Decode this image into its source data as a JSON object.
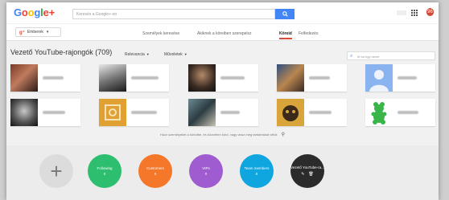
{
  "header": {
    "logo_letters": [
      {
        "ch": "G",
        "color": "#4285f4"
      },
      {
        "ch": "o",
        "color": "#ea4335"
      },
      {
        "ch": "o",
        "color": "#fbbc05"
      },
      {
        "ch": "g",
        "color": "#4285f4"
      },
      {
        "ch": "l",
        "color": "#34a853"
      },
      {
        "ch": "e",
        "color": "#ea4335"
      },
      {
        "ch": "+",
        "color": "#ea4335"
      }
    ],
    "search_placeholder": "Keresés a Google+-on",
    "notif_count": "96"
  },
  "nav": {
    "people_label": "Emberek",
    "tabs": [
      "Személyek keresése",
      "Akiknek a köreiben szerepelsz",
      "Köreid",
      "Felfedezés"
    ],
    "active_tab": "Köreid"
  },
  "circle": {
    "title": "Vezető YouTube-rajongók (709)",
    "sort_label": "Relevancia",
    "actions_label": "Műveletek",
    "find_placeholder": "Itt ba egy nevet"
  },
  "hint": "Húzz személyeket a körödbe, és közvetlen körd, vagy vissz meg tartalmakat vélük",
  "circles": [
    {
      "label": "",
      "count": "",
      "color": "#dcdcdc"
    },
    {
      "label": "Following",
      "count": "0",
      "color": "#2dbf6f"
    },
    {
      "label": "Customers",
      "count": "0",
      "color": "#f4772a"
    },
    {
      "label": "VIPs",
      "count": "0",
      "color": "#9f5bd0"
    },
    {
      "label": "Team members",
      "count": "0",
      "color": "#0fa6e0"
    },
    {
      "label": "Vezető YouTube-ra...",
      "count": "",
      "color": "#2b2b2b"
    }
  ],
  "colors": {
    "accent": "#dd4b39",
    "search": "#4285f4"
  }
}
